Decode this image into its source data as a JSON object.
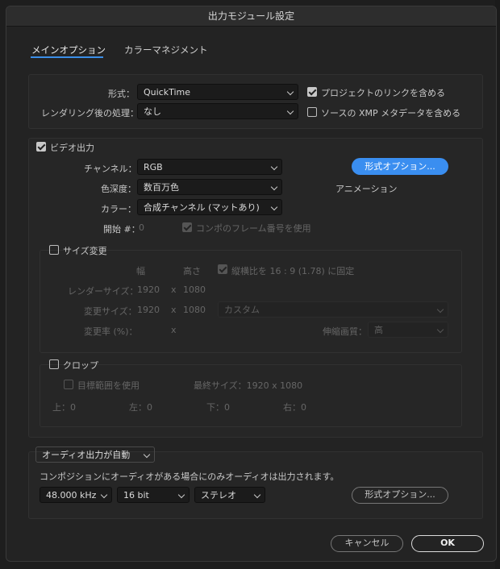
{
  "dialog_title": "出力モジュール設定",
  "tabs": [
    {
      "label": "メインオプション",
      "active": true
    },
    {
      "label": "カラーマネジメント",
      "active": false
    }
  ],
  "format": {
    "label": "形式：",
    "value": "QuickTime"
  },
  "post_render": {
    "label": "レンダリング後の処理：",
    "value": "なし"
  },
  "include_project_link": {
    "label": "プロジェクトのリンクを含める",
    "checked": true
  },
  "include_xmp": {
    "label": "ソースの XMP メタデータを含める",
    "checked": false
  },
  "video": {
    "label": "ビデオ出力",
    "checked": true,
    "channels": {
      "label": "チャンネル：",
      "value": "RGB"
    },
    "depth": {
      "label": "色深度：",
      "value": "数百万色"
    },
    "color": {
      "label": "カラー：",
      "value": "合成チャンネル (マットあり)"
    },
    "start": {
      "label": "開始 #：",
      "value": "0"
    },
    "use_comp_frame": {
      "label": "コンポのフレーム番号を使用",
      "checked": true
    },
    "format_options_button": "形式オプション...",
    "codec_text": "アニメーション"
  },
  "resize": {
    "label": "サイズ変更",
    "checked": false,
    "col_width": "幅",
    "col_height": "高さ",
    "lock_aspect": {
      "label": "縦横比を 16 : 9 (1.78) に固定",
      "checked": true
    },
    "render_size": {
      "label": "レンダーサイズ：",
      "w": "1920",
      "x": "x",
      "h": "1080"
    },
    "resize_to": {
      "label": "変更サイズ：",
      "w": "1920",
      "x": "x",
      "h": "1080",
      "preset": "カスタム"
    },
    "resize_pct": {
      "label": "変更率 (%)：",
      "x": "x"
    },
    "quality": {
      "label": "伸縮画質：",
      "value": "高"
    }
  },
  "crop": {
    "label": "クロップ",
    "checked": false,
    "use_roi": {
      "label": "目標範囲を使用",
      "checked": false
    },
    "final_size": "最終サイズ：1920 x 1080",
    "top": "上：0",
    "left": "左：0",
    "bottom": "下：0",
    "right": "右：0"
  },
  "audio": {
    "mode": "オーディオ出力が自動",
    "message": "コンポジションにオーディオがある場合にのみオーディオは出力されます。",
    "rate": "48.000 kHz",
    "bits": "16 bit",
    "channels": "ステレオ",
    "format_options_button": "形式オプション..."
  },
  "cancel_button": "キャンセル",
  "ok_button": "OK",
  "accent_color": "#3a8ef0"
}
